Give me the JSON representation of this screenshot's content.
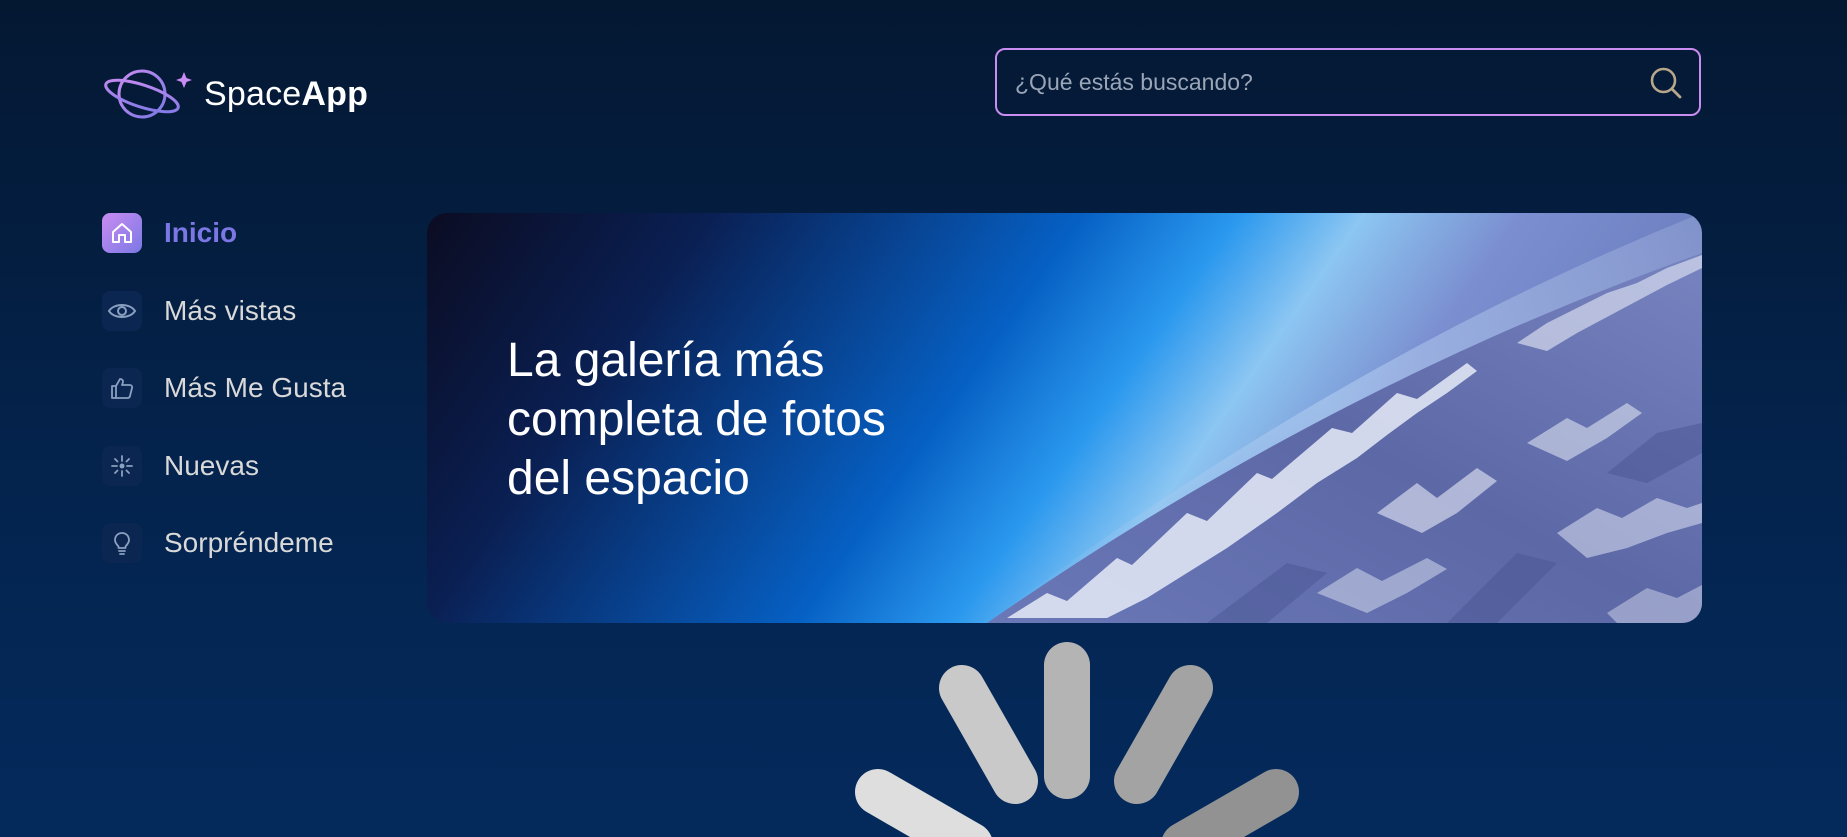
{
  "brand": {
    "name_regular": "Space",
    "name_bold": "App",
    "logo_icon": "planet-icon",
    "colors": {
      "gradient_start": "#c98cf1",
      "gradient_end": "#7b78e5"
    }
  },
  "search": {
    "placeholder": "¿Qué estás buscando?",
    "value": "",
    "icon": "search-icon",
    "border_color": "#c98cf1"
  },
  "sidebar": {
    "items": [
      {
        "label": "Inicio",
        "icon": "home-icon",
        "active": true
      },
      {
        "label": "Más vistas",
        "icon": "eye-icon",
        "active": false
      },
      {
        "label": "Más Me Gusta",
        "icon": "thumbs-up-icon",
        "active": false
      },
      {
        "label": "Nuevas",
        "icon": "sparkle-icon",
        "active": false
      },
      {
        "label": "Sorpréndeme",
        "icon": "lightbulb-icon",
        "active": false
      }
    ],
    "active_color": "#7b78e5"
  },
  "banner": {
    "title": "La galería más completa de fotos del espacio"
  },
  "loading": {
    "icon": "loading-spinner-icon"
  },
  "colors": {
    "background_top": "#041832",
    "background_bottom": "#042a5c",
    "text": "#d9d9d9"
  }
}
